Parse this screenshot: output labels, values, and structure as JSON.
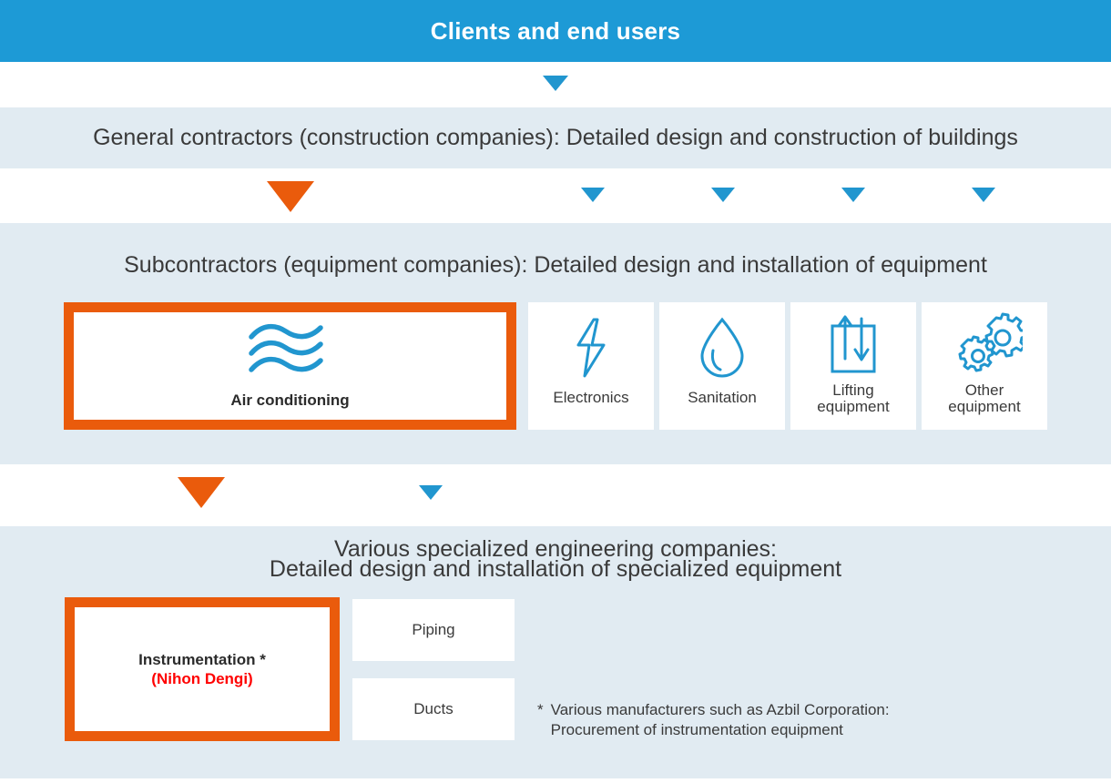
{
  "header": {
    "title": "Clients and end users",
    "background_color": "#1d9ad6",
    "text_color": "#ffffff"
  },
  "colors": {
    "accent_blue": "#1d9ad6",
    "arrow_blue": "#2196cf",
    "accent_orange": "#ea5b0c",
    "band_background": "#e1ebf2",
    "card_background": "#ffffff",
    "highlight_text_red": "#ff0000",
    "body_text": "#3a3a3a"
  },
  "arrows": {
    "row1": [
      {
        "name": "arrow-clients-to-general",
        "color": "#2196cf",
        "size": "small"
      }
    ],
    "row2": [
      {
        "name": "arrow-general-to-airconditioning",
        "color": "#ea5b0c",
        "size": "large"
      },
      {
        "name": "arrow-general-to-electronics",
        "color": "#2196cf",
        "size": "small"
      },
      {
        "name": "arrow-general-to-sanitation",
        "color": "#2196cf",
        "size": "small"
      },
      {
        "name": "arrow-general-to-lifting",
        "color": "#2196cf",
        "size": "small"
      },
      {
        "name": "arrow-general-to-other",
        "color": "#2196cf",
        "size": "small"
      }
    ],
    "row3": [
      {
        "name": "arrow-airconditioning-to-instrumentation",
        "color": "#ea5b0c",
        "size": "large"
      },
      {
        "name": "arrow-airconditioning-to-piping",
        "color": "#2196cf",
        "size": "small"
      }
    ]
  },
  "section_general": {
    "heading": "General contractors (construction companies): Detailed design and construction of buildings"
  },
  "section_subcontractors": {
    "heading": "Subcontractors (equipment companies): Detailed design and installation of equipment",
    "cards": [
      {
        "label": "Air conditioning",
        "icon": "air-waves-icon",
        "highlighted": true
      },
      {
        "label": "Electronics",
        "icon": "lightning-bolt-icon",
        "highlighted": false
      },
      {
        "label": "Sanitation",
        "icon": "water-drop-icon",
        "highlighted": false
      },
      {
        "label_line1": "Lifting",
        "label_line2": "equipment",
        "icon": "elevator-icon",
        "highlighted": false
      },
      {
        "label_line1": "Other",
        "label_line2": "equipment",
        "icon": "gears-icon",
        "highlighted": false
      }
    ]
  },
  "section_specialized": {
    "heading_line1": "Various specialized engineering companies:",
    "heading_line2": "Detailed design and installation of specialized equipment",
    "instrumentation_card": {
      "line1": "Instrumentation *",
      "line2": "(Nihon Dengi)",
      "highlighted": true
    },
    "subcards": [
      {
        "label": "Piping"
      },
      {
        "label": "Ducts"
      }
    ],
    "footnote": {
      "mark": "*",
      "line1": "Various manufacturers such as Azbil Corporation:",
      "line2": "Procurement of instrumentation equipment"
    }
  }
}
